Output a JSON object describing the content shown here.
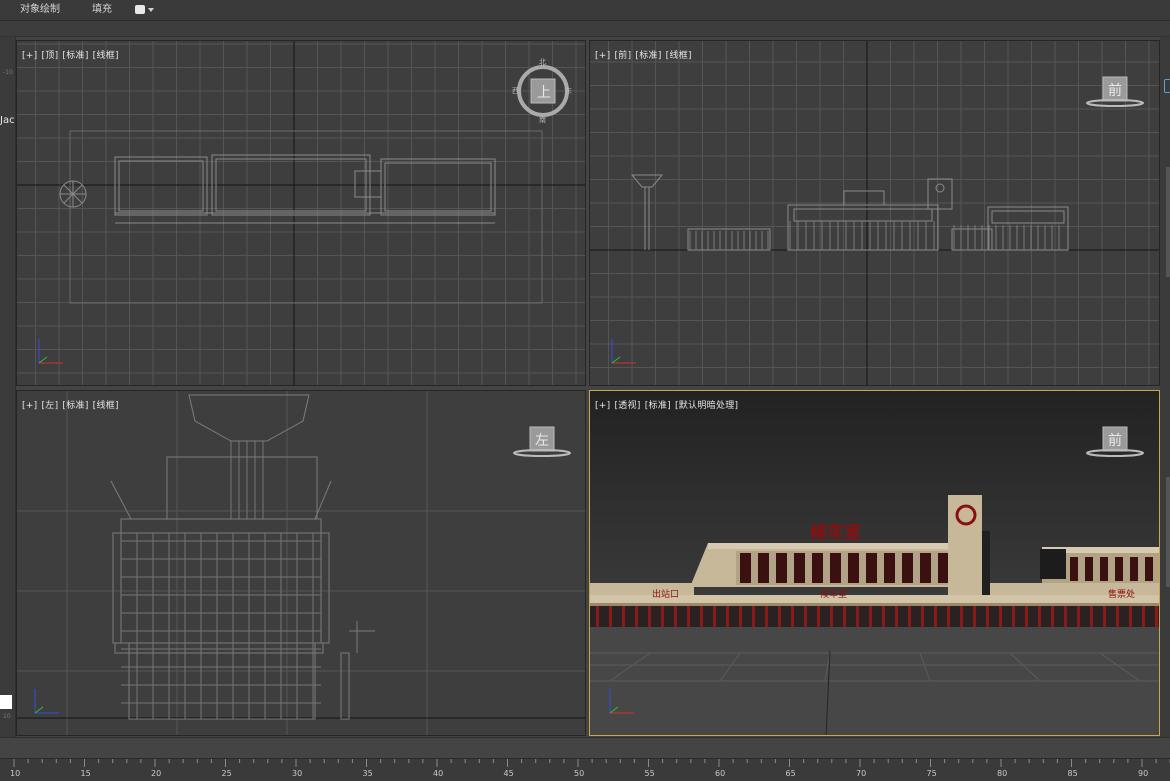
{
  "menubar": {
    "item_object_paint": "对象绘制",
    "item_fill": "填充"
  },
  "left_panel": {
    "truncated_label": "Jac"
  },
  "viewports": [
    {
      "id": "top",
      "labels": [
        "[+]",
        "[顶]",
        "[标准]",
        "[线框]"
      ],
      "viewcube_text": "上",
      "compass": [
        "北",
        "东",
        "南",
        "西"
      ]
    },
    {
      "id": "front",
      "labels": [
        "[+]",
        "[前]",
        "[标准]",
        "[线框]"
      ],
      "viewcube_text": "前"
    },
    {
      "id": "left",
      "labels": [
        "[+]",
        "[左]",
        "[标准]",
        "[线框]"
      ],
      "viewcube_text": "左"
    },
    {
      "id": "perspective",
      "labels": [
        "[+]",
        "[透视]",
        "[标准]",
        "[默认明暗处理]"
      ],
      "viewcube_text": "前",
      "active": true
    }
  ],
  "building_signs": {
    "main_title": "候车室",
    "left_sign": "出站口",
    "center_sign": "候车室",
    "right_sign": "售票处"
  },
  "ruler": {
    "ticks": [
      "10",
      "15",
      "20",
      "25",
      "30",
      "35",
      "40",
      "45",
      "50",
      "55",
      "60",
      "65",
      "70",
      "75",
      "80",
      "85",
      "90"
    ]
  },
  "colors": {
    "active_viewport_border": "#c8a550",
    "grid_line": "#5a5a5a",
    "axis_x": "#d03030",
    "axis_y": "#30c030",
    "axis_z": "#3050e0",
    "building_wall": "#c8b89a",
    "sign_red": "#8a1010"
  }
}
